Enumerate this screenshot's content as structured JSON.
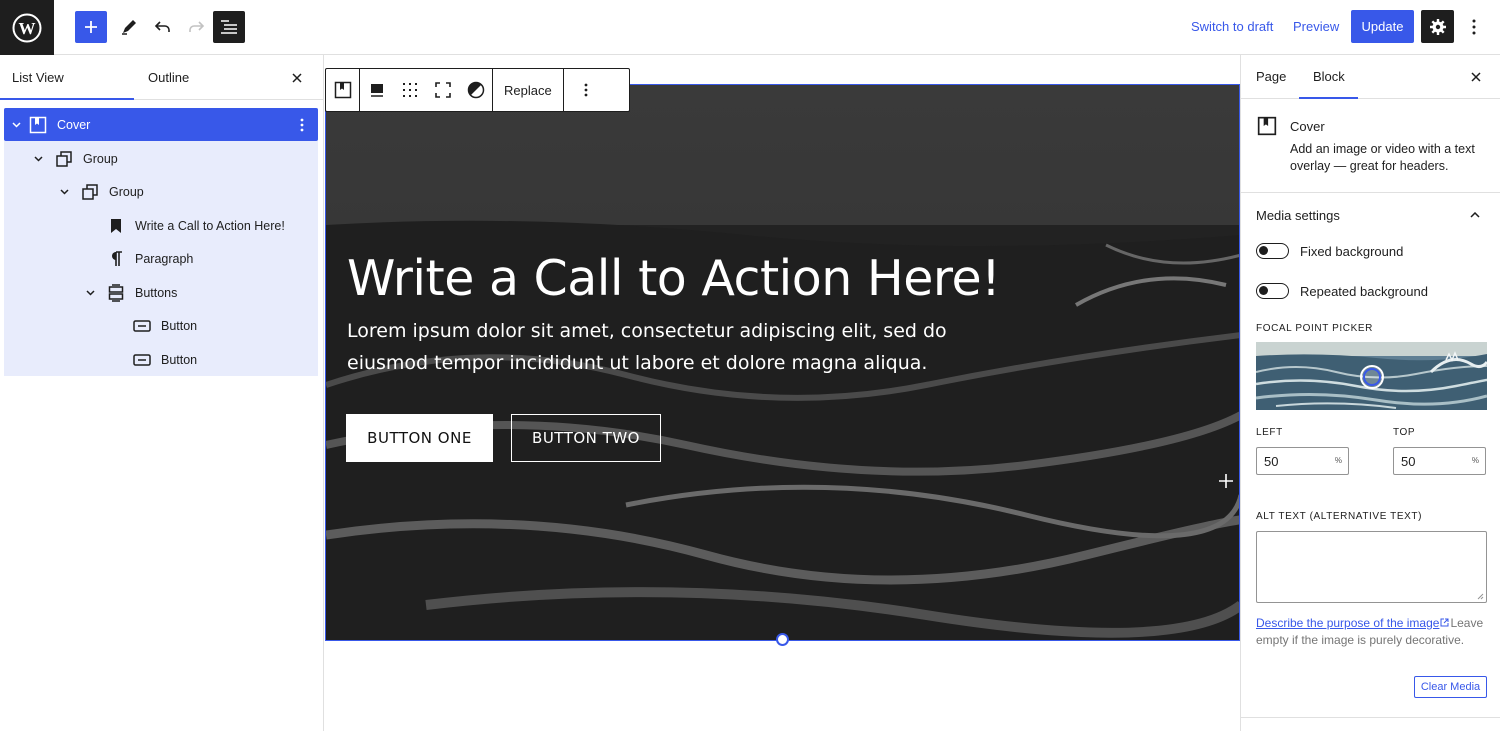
{
  "header": {
    "switch_to_draft": "Switch to draft",
    "preview": "Preview",
    "update": "Update",
    "accent": "#3858e9"
  },
  "left_panel": {
    "tabs": [
      "List View",
      "Outline"
    ],
    "tree": [
      {
        "label": "Cover",
        "icon": "cover-icon",
        "selected": true
      },
      {
        "label": "Group",
        "icon": "group-icon"
      },
      {
        "label": "Group",
        "icon": "group-icon"
      },
      {
        "label": "Write a Call to Action Here!",
        "icon": "heading-bookmark-icon"
      },
      {
        "label": "Paragraph",
        "icon": "paragraph-icon"
      },
      {
        "label": "Buttons",
        "icon": "buttons-icon"
      },
      {
        "label": "Button",
        "icon": "button-icon"
      },
      {
        "label": "Button",
        "icon": "button-icon"
      }
    ]
  },
  "block_toolbar": {
    "replace": "Replace"
  },
  "cover": {
    "title": "Write a Call to Action Here!",
    "paragraph": "Lorem ipsum dolor sit amet, consectetur adipiscing elit, sed do eiusmod tempor incididunt ut labore et dolore magna aliqua.",
    "button_one": "BUTTON ONE",
    "button_two": "BUTTON TWO"
  },
  "right_panel": {
    "tabs": [
      "Page",
      "Block"
    ],
    "block_title": "Cover",
    "block_desc": "Add an image or video with a text overlay — great for headers.",
    "media_settings": "Media settings",
    "fixed_background": "Fixed background",
    "repeated_background": "Repeated background",
    "focal_point_picker": "FOCAL POINT PICKER",
    "left_label": "LEFT",
    "top_label": "TOP",
    "left_value": "50",
    "top_value": "50",
    "unit": "%",
    "alt_text_label": "ALT TEXT (ALTERNATIVE TEXT)",
    "alt_help_link": "Describe the purpose of the image",
    "alt_help_text": "Leave empty if the image is purely decorative.",
    "clear_media": "Clear Media"
  }
}
